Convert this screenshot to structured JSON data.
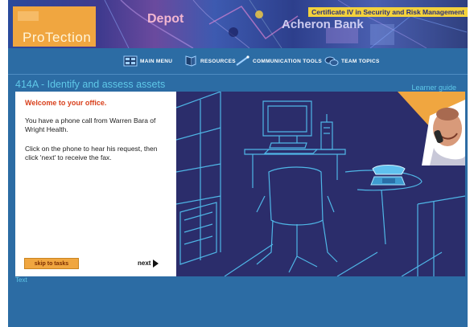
{
  "header": {
    "logo_text": "ProTection",
    "depot_text": "Depot",
    "bank_text": "Acheron Bank",
    "certificate": "Certificate IV in Security and Risk Management"
  },
  "nav": [
    {
      "label": "MAIN MENU",
      "icon": "main-menu-icon"
    },
    {
      "label": "RESOURCES",
      "icon": "resources-icon"
    },
    {
      "label": "COMMUNICATION TOOLS",
      "icon": "communication-tools-icon"
    },
    {
      "label": "TEAM TOPICS",
      "icon": "team-topics-icon"
    }
  ],
  "page": {
    "title": "414A - Identify and assess assets",
    "learner_guide": "Learner guide"
  },
  "panel": {
    "heading": "Welcome to your office.",
    "paragraph1": "You have a phone call from Warren Bara of Wright Health.",
    "paragraph2": "Click on the phone to hear his request, then click 'next' to receive the fax.",
    "skip_label": "skip to tasks",
    "next_label": "next"
  },
  "footer": {
    "text_link": "Text"
  },
  "colors": {
    "page_bg": "#2c6ca4",
    "scene_bg": "#2b2d6b",
    "line_art": "#4fb6e6",
    "accent_orange": "#f0a640",
    "heading_red": "#d8401c",
    "title_cyan": "#5fc8e8",
    "certificate_bg": "#f3d23c"
  }
}
